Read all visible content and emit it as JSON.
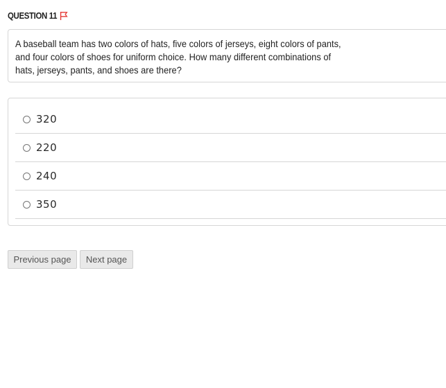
{
  "question": {
    "header": "QUESTION 11",
    "flag_icon": "flag-icon",
    "flag_color": "#e53935",
    "text_lines": [
      "A baseball team has two colors of hats, five colors of jerseys, eight colors of pants,",
      "and four colors of shoes for uniform choice. How many different combinations of",
      "hats, jerseys, pants, and shoes are there?"
    ]
  },
  "answers": [
    {
      "label": "320",
      "selected": false
    },
    {
      "label": "220",
      "selected": false
    },
    {
      "label": "240",
      "selected": false
    },
    {
      "label": "350",
      "selected": false
    }
  ],
  "navigation": {
    "previous_label": "Previous page",
    "next_label": "Next page"
  }
}
